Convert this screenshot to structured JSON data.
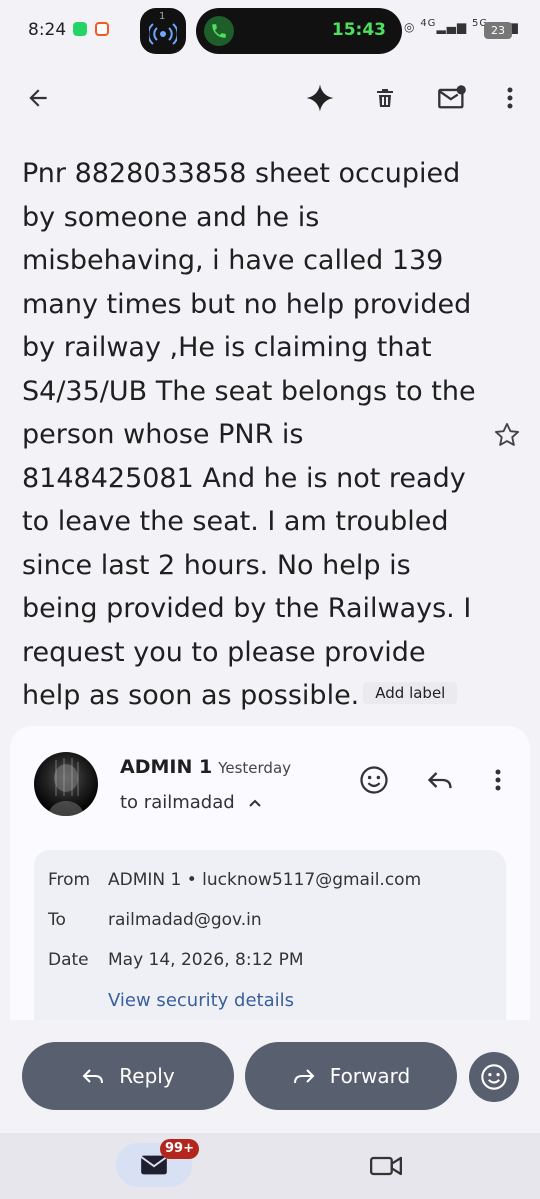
{
  "status_bar": {
    "time": "8:24",
    "call_time": "15:43",
    "network_4g": "4G",
    "network_5g": "5G",
    "battery": "23",
    "call_indicator_number": "1"
  },
  "toolbar": {
    "back": "back-arrow-icon",
    "gemini": "sparkle-icon",
    "delete": "trash-icon",
    "mark_unread": "mail-unread-icon",
    "more": "more-vert-icon"
  },
  "email": {
    "subject": "Pnr 8828033858 sheet occupied by someone and he is misbehaving, i have called 139 many times but no help provided by railway ,He is claiming that S4/35/UB The seat belongs to the person whose PNR is 8148425081 And he is not ready to leave the seat. I am troubled since last 2 hours. No help is being provided by the Railways. I request you to please provide help as soon as possible.",
    "add_label": "Add label",
    "sender_name": "ADMIN 1",
    "sender_time": "Yesterday",
    "to_line": "to railmadad",
    "details": {
      "from_label": "From",
      "from_value": "ADMIN 1 • lucknow5117@gmail.com",
      "to_label": "To",
      "to_value": "railmadad@gov.in",
      "date_label": "Date",
      "date_value": "May 14, 2026, 8:12 PM",
      "security_link": "View security details"
    }
  },
  "actions": {
    "reply": "Reply",
    "forward": "Forward"
  },
  "nav": {
    "mail_badge": "99+"
  },
  "colors": {
    "background": "#f3f3f7",
    "pill_button": "#58606f",
    "badge": "#b3261e",
    "link": "#3a5f9c",
    "call_green": "#4ee05c"
  }
}
